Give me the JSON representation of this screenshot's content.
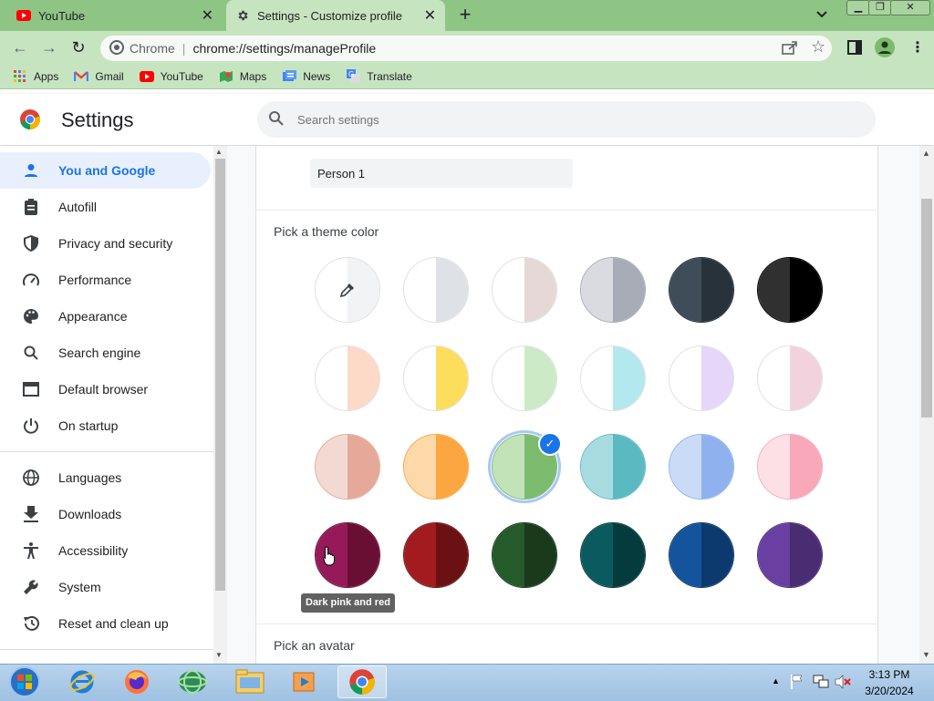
{
  "tabs": [
    {
      "title": "YouTube",
      "icon": "youtube-icon",
      "active": false
    },
    {
      "title": "Settings - Customize profile",
      "icon": "gear-icon",
      "active": true
    }
  ],
  "omnibox": {
    "site_label": "Chrome",
    "url": "chrome://settings/manageProfile"
  },
  "bookmarks": [
    {
      "label": "Apps",
      "icon": "apps-grid-icon"
    },
    {
      "label": "Gmail",
      "icon": "gmail-icon"
    },
    {
      "label": "YouTube",
      "icon": "youtube-icon"
    },
    {
      "label": "Maps",
      "icon": "maps-icon"
    },
    {
      "label": "News",
      "icon": "news-icon"
    },
    {
      "label": "Translate",
      "icon": "translate-icon"
    }
  ],
  "header": {
    "title": "Settings",
    "search_placeholder": "Search settings"
  },
  "sidebar": {
    "items": [
      {
        "label": "You and Google",
        "icon": "person-icon",
        "active": true
      },
      {
        "label": "Autofill",
        "icon": "clipboard-icon"
      },
      {
        "label": "Privacy and security",
        "icon": "shield-icon"
      },
      {
        "label": "Performance",
        "icon": "speedometer-icon"
      },
      {
        "label": "Appearance",
        "icon": "palette-icon"
      },
      {
        "label": "Search engine",
        "icon": "search-icon"
      },
      {
        "label": "Default browser",
        "icon": "browser-window-icon"
      },
      {
        "label": "On startup",
        "icon": "power-icon"
      },
      {
        "label": "Languages",
        "icon": "globe-icon"
      },
      {
        "label": "Downloads",
        "icon": "download-icon"
      },
      {
        "label": "Accessibility",
        "icon": "accessibility-icon"
      },
      {
        "label": "System",
        "icon": "wrench-icon"
      },
      {
        "label": "Reset and clean up",
        "icon": "history-reset-icon"
      }
    ]
  },
  "profile": {
    "name_value": "Person 1",
    "theme_section_title": "Pick a theme color",
    "avatar_section_title": "Pick an avatar",
    "tooltip": "Dark pink and red",
    "colors": {
      "accent": "#1a73e8",
      "selected_ring": "#a8c7fa"
    },
    "theme_rows": [
      [
        [
          "#ffffff",
          "#f1f3f4"
        ],
        [
          "#ffffff",
          "#dee1e6"
        ],
        [
          "#ffffff",
          "#e6d8d6"
        ],
        [
          "#d9dbe0",
          "#a8acb6"
        ],
        [
          "#3e4d58",
          "#28323a"
        ],
        [
          "#303030",
          "#000000"
        ]
      ],
      [
        [
          "#ffffff",
          "#fdd9c8"
        ],
        [
          "#ffffff",
          "#fddd5c"
        ],
        [
          "#ffffff",
          "#cceac6"
        ],
        [
          "#ffffff",
          "#b3e8ef"
        ],
        [
          "#ffffff",
          "#e6d6f9"
        ],
        [
          "#ffffff",
          "#f2d3dd"
        ]
      ],
      [
        [
          "#f2d9d2",
          "#e4a999"
        ],
        [
          "#fdd8a8",
          "#fba640"
        ],
        [
          "#c2e2b8",
          "#7cba6e"
        ],
        [
          "#a8dbe0",
          "#5bb9c2"
        ],
        [
          "#c9dbf7",
          "#8fb2ee"
        ],
        [
          "#fde0e6",
          "#f8a8b8"
        ]
      ],
      [
        [
          "#961a5a",
          "#6a0f34"
        ],
        [
          "#a11b1f",
          "#6c1113"
        ],
        [
          "#255a2a",
          "#193b1c"
        ],
        [
          "#0b5a5f",
          "#063b3e"
        ],
        [
          "#14549c",
          "#0c3a6e"
        ],
        [
          "#6a3fa2",
          "#4a2c73"
        ]
      ]
    ],
    "selected": {
      "row": 2,
      "col": 2
    },
    "eyedropper_icon": "eyedropper-icon"
  },
  "taskbar": {
    "apps": [
      "start-orb-icon",
      "internet-explorer-icon",
      "firefox-icon",
      "network-globe-icon",
      "file-explorer-icon",
      "media-player-icon",
      "chrome-icon"
    ],
    "time": "3:13 PM",
    "date": "3/20/2024"
  }
}
